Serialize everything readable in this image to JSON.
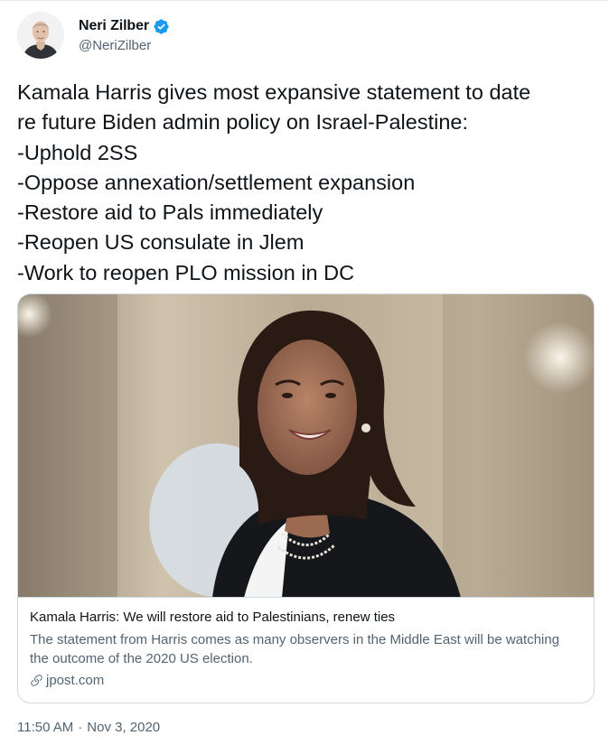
{
  "author": {
    "display_name": "Neri Zilber",
    "handle": "@NeriZilber",
    "verified": true,
    "verified_color": "#1d9bf0"
  },
  "tweet": {
    "lines": [
      "Kamala Harris gives most expansive statement to date",
      "re future Biden admin policy on Israel-Palestine:",
      "-Uphold 2SS",
      "-Oppose annexation/settlement expansion",
      "-Restore aid to Pals immediately",
      "-Reopen US consulate in Jlem",
      "-Work to reopen PLO mission in DC"
    ]
  },
  "card": {
    "image_icon": "portrait-photo",
    "title": "Kamala Harris: We will restore aid to Palestinians, renew ties",
    "description": "The statement from Harris comes as many observers in the Middle East will be watching the outcome of the 2020 US election.",
    "domain": "jpost.com",
    "domain_icon": "link-icon"
  },
  "meta": {
    "time": "11:50 AM",
    "separator": "·",
    "date": "Nov 3, 2020"
  }
}
